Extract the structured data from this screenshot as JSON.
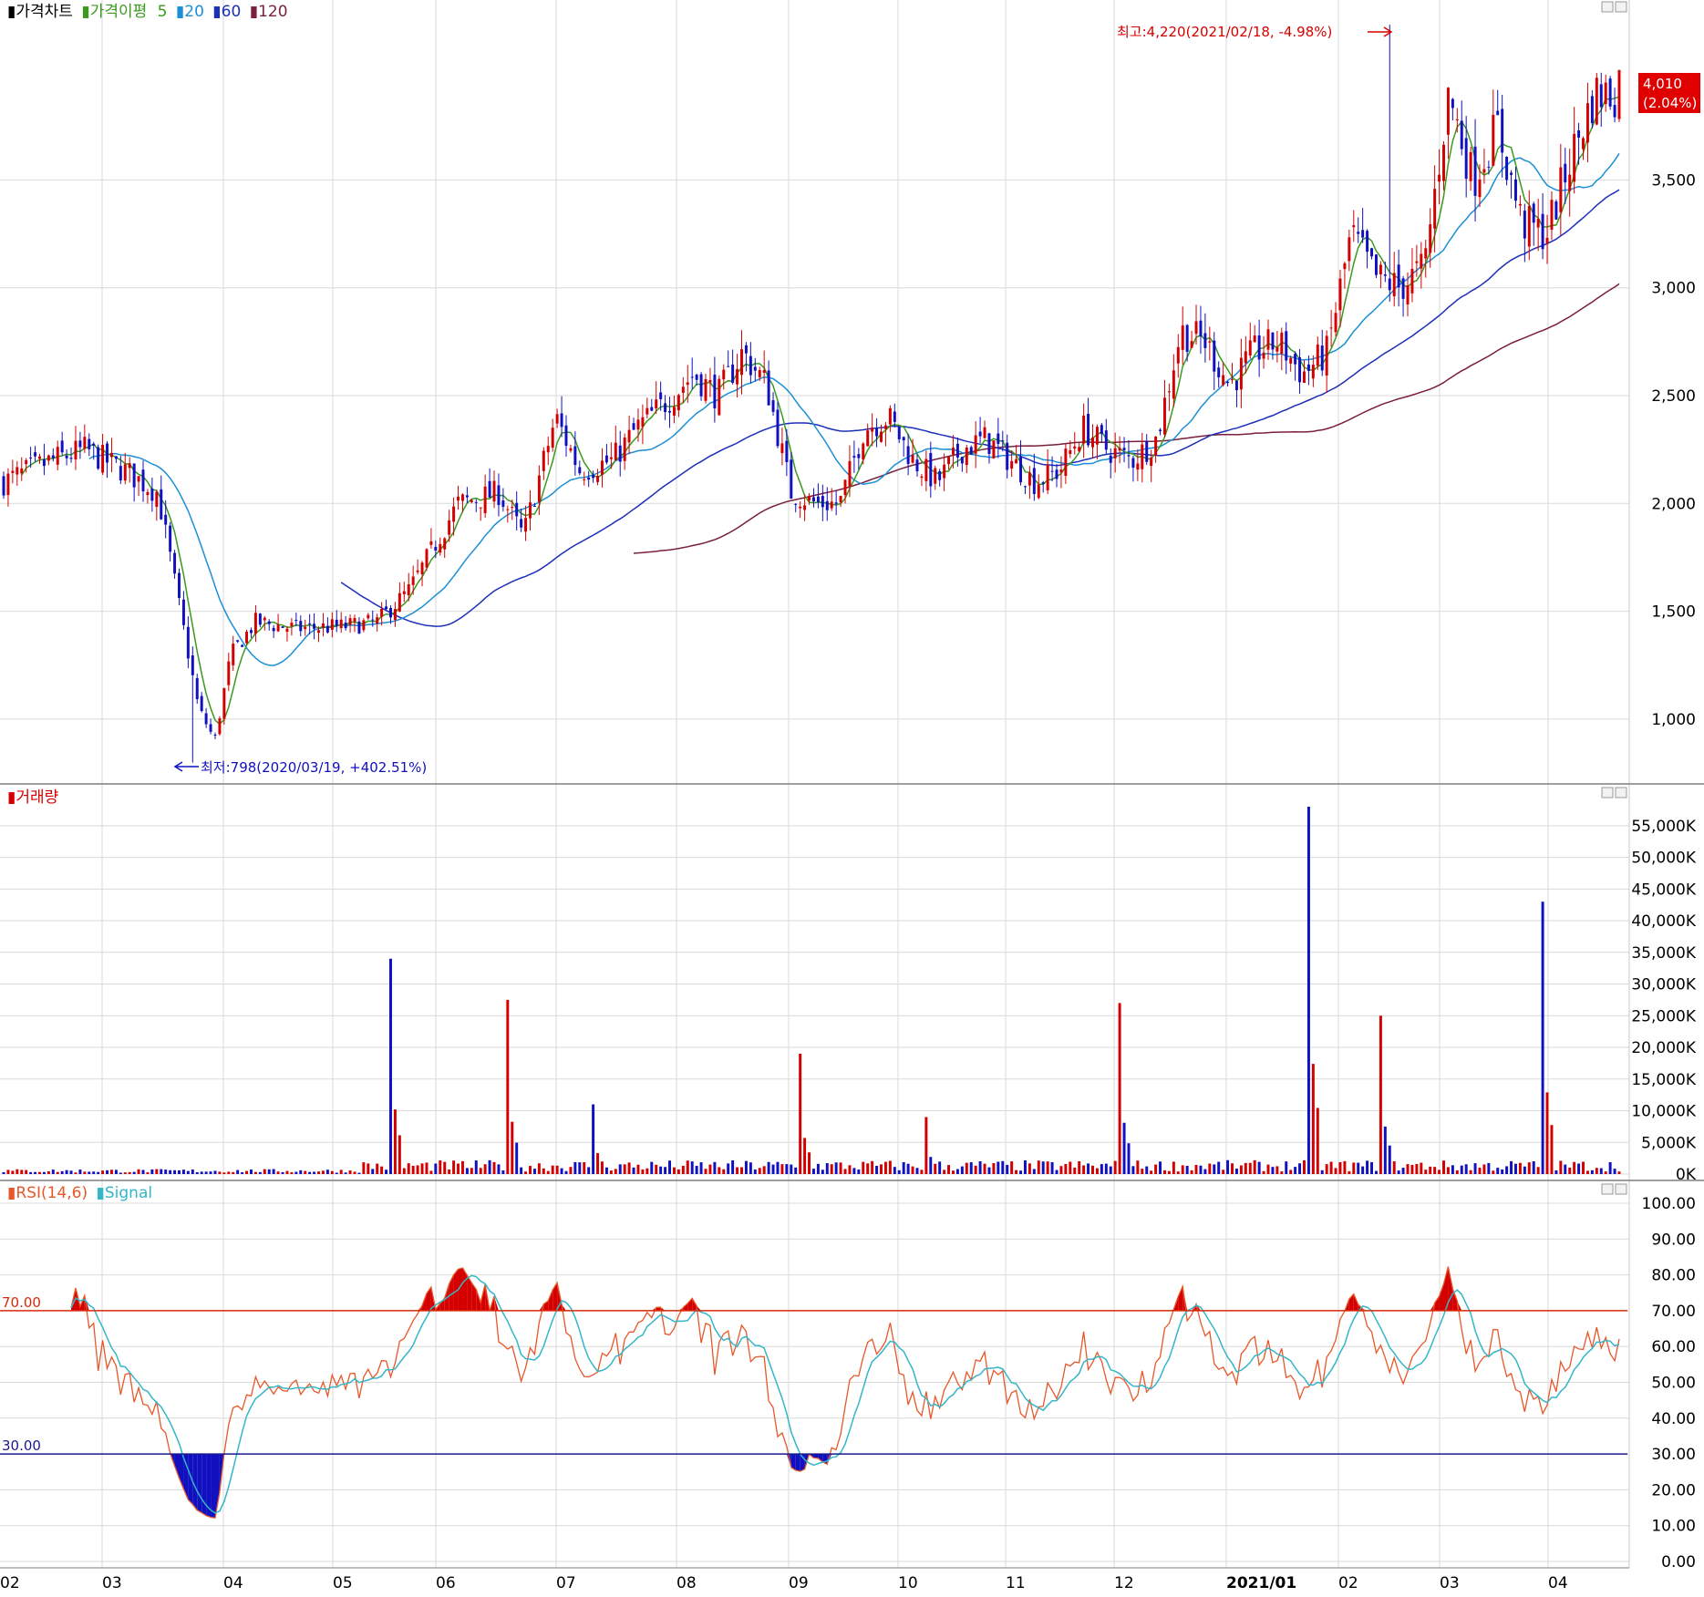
{
  "panels": {
    "price": {
      "legend": [
        {
          "text": "가격차트",
          "color": "#000000"
        },
        {
          "text": "가격이평",
          "color": "#3a9a1e"
        },
        {
          "text": "5",
          "color": "#3a9a1e"
        },
        {
          "text": "20",
          "color": "#1c8fd6"
        },
        {
          "text": "60",
          "color": "#1c2fb8"
        },
        {
          "text": "120",
          "color": "#7a1f3c"
        }
      ],
      "y_ticks": [
        "1,000",
        "1,500",
        "2,000",
        "2,500",
        "3,000",
        "3,500"
      ],
      "high_label": "최고:4,220(2021/02/18, -4.98%)",
      "low_label": "최저:798(2020/03/19, +402.51%)",
      "last_price": "4,010",
      "last_change": "(2.04%)"
    },
    "volume": {
      "legend": [
        {
          "text": "거래량",
          "color": "#d40000"
        }
      ],
      "y_ticks": [
        "0K",
        "5,000K",
        "10,000K",
        "15,000K",
        "20,000K",
        "25,000K",
        "30,000K",
        "35,000K",
        "40,000K",
        "45,000K",
        "50,000K",
        "55,000K"
      ]
    },
    "rsi": {
      "legend": [
        {
          "text": "RSI(14,6)",
          "color": "#e8572a"
        },
        {
          "text": "Signal",
          "color": "#34b6c8"
        }
      ],
      "y_ticks": [
        "0.00",
        "10.00",
        "20.00",
        "30.00",
        "40.00",
        "50.00",
        "60.00",
        "70.00",
        "80.00",
        "90.00",
        "100.00"
      ],
      "upper_label": "70.00",
      "lower_label": "30.00"
    }
  },
  "x_axis": {
    "labels": [
      "02",
      "03",
      "04",
      "05",
      "06",
      "07",
      "08",
      "09",
      "10",
      "11",
      "12",
      "2021/01",
      "02",
      "03",
      "04"
    ]
  },
  "colors": {
    "up": "#d40000",
    "down": "#1010c0",
    "ma5": "#3a9a1e",
    "ma20": "#1c8fd6",
    "ma60": "#1c2fb8",
    "ma120": "#7a1f3c",
    "rsi": "#e8572a",
    "signal": "#34b6c8",
    "rsi_upper_line": "#d62a0a",
    "rsi_lower_line": "#1a1a8c",
    "grid": "#d9d9d9"
  },
  "chart_data": [
    {
      "type": "candlestick",
      "x": [
        "2020-02",
        "2020-03",
        "2020-04",
        "2020-05",
        "2020-06",
        "2020-07",
        "2020-08",
        "2020-09",
        "2020-10",
        "2020-11",
        "2020-12",
        "2021-01",
        "2021-02",
        "2021-03",
        "2021-04"
      ],
      "close": [
        2100,
        900,
        1450,
        1500,
        2150,
        2200,
        2600,
        2100,
        2200,
        2150,
        2850,
        2650,
        3850,
        3300,
        4010
      ],
      "high": [
        2400,
        2200,
        1800,
        1750,
        2700,
        2650,
        2750,
        2750,
        2550,
        2450,
        3000,
        2850,
        4220,
        3850,
        4150
      ],
      "low": [
        2000,
        798,
        1200,
        1400,
        1500,
        1800,
        1900,
        1850,
        2000,
        2000,
        2200,
        2500,
        2800,
        3150,
        3350
      ],
      "ma": {
        "ma20": [
          2150,
          1500,
          1400,
          1450,
          1800,
          2100,
          2500,
          2200,
          2250,
          2200,
          2500,
          2700,
          3300,
          3500,
          3720
        ],
        "ma60": [
          null,
          null,
          null,
          1700,
          1550,
          1700,
          2000,
          2250,
          2300,
          2200,
          2300,
          2450,
          2800,
          3150,
          3450
        ],
        "ma120": [
          null,
          null,
          null,
          null,
          null,
          null,
          1850,
          1900,
          2050,
          2150,
          2250,
          2350,
          2450,
          2700,
          2960
        ]
      },
      "y_ticks": [
        1000,
        1500,
        2000,
        2500,
        3000,
        3500
      ],
      "ylim": [
        750,
        4250
      ],
      "annotations": {
        "max": {
          "value": 4220,
          "date": "2021/02/18",
          "change": "-4.98%"
        },
        "min": {
          "value": 798,
          "date": "2020/03/19",
          "change": "+402.51%"
        },
        "last": {
          "value": 4010,
          "change": "2.04%"
        }
      }
    },
    {
      "type": "bar",
      "x": [
        "2020-02",
        "2020-03",
        "2020-04",
        "2020-05",
        "2020-06",
        "2020-07",
        "2020-08",
        "2020-09",
        "2020-10",
        "2020-11",
        "2020-12",
        "2021-01",
        "2021-02",
        "2021-03",
        "2021-04"
      ],
      "peaks_K": [
        34000,
        27500,
        11000,
        19000,
        9000,
        27000,
        58000,
        25000,
        43000
      ],
      "ylim": [
        0,
        58000
      ],
      "y_ticks": [
        0,
        5000,
        10000,
        15000,
        20000,
        25000,
        30000,
        35000,
        40000,
        45000,
        50000,
        55000
      ],
      "unit": "K"
    },
    {
      "type": "line",
      "series": [
        {
          "name": "RSI(14,6)",
          "values": [
            58,
            12,
            55,
            60,
            78,
            60,
            68,
            15,
            70,
            28,
            78,
            55,
            68,
            62,
            70
          ]
        },
        {
          "name": "Signal",
          "values": [
            52,
            20,
            50,
            55,
            72,
            58,
            62,
            20,
            64,
            32,
            72,
            52,
            64,
            60,
            70
          ]
        }
      ],
      "ylim": [
        0,
        100
      ],
      "y_ticks": [
        0,
        10,
        20,
        30,
        40,
        50,
        60,
        70,
        80,
        90,
        100
      ],
      "reference_lines": [
        70,
        30
      ]
    }
  ]
}
